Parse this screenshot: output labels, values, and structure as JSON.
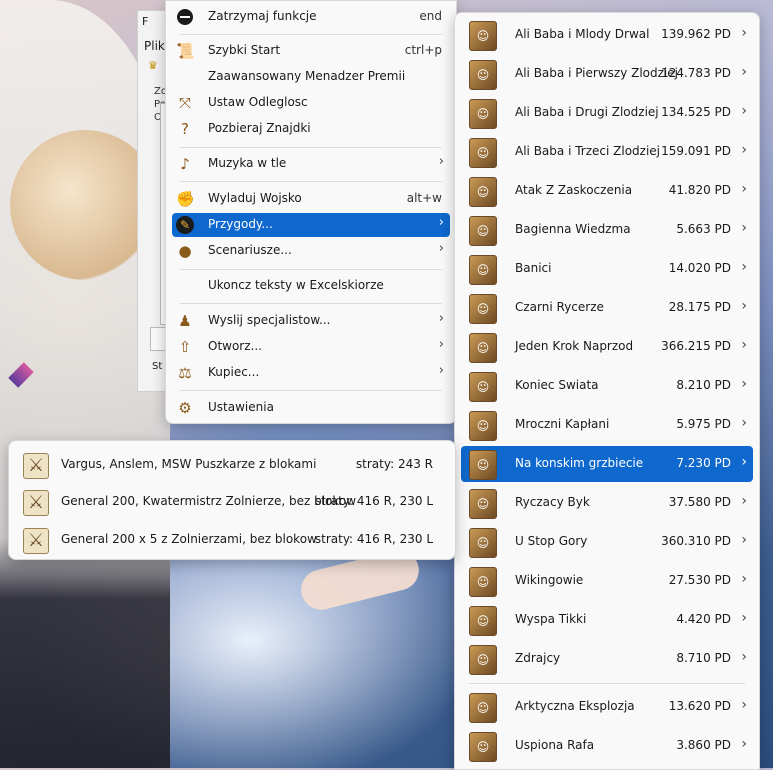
{
  "app_window": {
    "title": "F",
    "menu_label": "Plik",
    "lines": [
      "Zo",
      "Po",
      "Ob"
    ],
    "status": "St"
  },
  "main_menu": {
    "items": [
      {
        "label": "Zatrzymaj funkcje",
        "shortcut": "end",
        "icon": "stop-icon"
      },
      {
        "label": "Szybki Start",
        "shortcut": "ctrl+p",
        "icon": "scroll-icon"
      },
      {
        "label": "Zaawansowany Menadzer Premii",
        "shortcut": "",
        "icon": ""
      },
      {
        "label": "Ustaw Odleglosc",
        "shortcut": "",
        "icon": "arrows-expand-icon"
      },
      {
        "label": "Pozbieraj Znajdki",
        "shortcut": "",
        "icon": "question-icon"
      },
      {
        "label": "Muzyka w tle",
        "shortcut": "",
        "icon": "music-note-icon",
        "arrow": true
      },
      {
        "label": "Wyladuj Wojsko",
        "shortcut": "alt+w",
        "icon": "army-icon"
      },
      {
        "label": "Przygody...",
        "shortcut": "",
        "icon": "adventure-brush-icon",
        "arrow": true,
        "selected": true
      },
      {
        "label": "Scenariusze...",
        "shortcut": "",
        "icon": "scenario-icon",
        "arrow": true
      },
      {
        "label": "Ukoncz teksty w Excelskiorze",
        "shortcut": "",
        "icon": ""
      },
      {
        "label": "Wyslij specjalistow...",
        "shortcut": "",
        "icon": "specialists-icon",
        "arrow": true
      },
      {
        "label": "Otworz...",
        "shortcut": "",
        "icon": "open-arrow-icon",
        "arrow": true
      },
      {
        "label": "Kupiec...",
        "shortcut": "",
        "icon": "scales-icon",
        "arrow": true
      },
      {
        "label": "Ustawienia",
        "shortcut": "",
        "icon": "settings-gear-icon"
      }
    ]
  },
  "adventures_menu": {
    "items": [
      {
        "label": "Ali Baba i Mlody Drwal",
        "value": "139.962 PD"
      },
      {
        "label": "Ali Baba i Pierwszy Zlodziej",
        "value": "124.783 PD"
      },
      {
        "label": "Ali Baba i Drugi Zlodziej",
        "value": "134.525 PD"
      },
      {
        "label": "Ali Baba i Trzeci Zlodziej",
        "value": "159.091 PD"
      },
      {
        "label": "Atak Z Zaskoczenia",
        "value": "41.820 PD"
      },
      {
        "label": "Bagienna Wiedzma",
        "value": "5.663 PD"
      },
      {
        "label": "Banici",
        "value": "14.020 PD"
      },
      {
        "label": "Czarni Rycerze",
        "value": "28.175 PD"
      },
      {
        "label": "Jeden Krok Naprzod",
        "value": "366.215 PD"
      },
      {
        "label": "Koniec Swiata",
        "value": "8.210 PD"
      },
      {
        "label": "Mroczni Kapłani",
        "value": "5.975 PD"
      },
      {
        "label": "Na konskim grzbiecie",
        "value": "7.230 PD",
        "selected": true
      },
      {
        "label": "Ryczacy Byk",
        "value": "37.580 PD"
      },
      {
        "label": "U Stop Gory",
        "value": "360.310 PD"
      },
      {
        "label": "Wikingowie",
        "value": "27.530 PD"
      },
      {
        "label": "Wyspa Tikki",
        "value": "4.420 PD"
      },
      {
        "label": "Zdrajcy",
        "value": "8.710 PD"
      },
      {
        "label": "Arktyczna Eksplozja",
        "value": "13.620 PD"
      },
      {
        "label": "Uspiona Rafa",
        "value": "3.860 PD"
      }
    ]
  },
  "strategy_popup": {
    "items": [
      {
        "label": "Vargus, Anslem, MSW Puszkarze z blokami",
        "losses": "straty: 243 R"
      },
      {
        "label": "General 200, Kwatermistrz Zolnierze, bez blokow",
        "losses": "straty: 416 R, 230 L"
      },
      {
        "label": "General 200 x 5 z Zolnierzami, bez blokow",
        "losses": "straty: 416 R, 230 L"
      }
    ]
  }
}
